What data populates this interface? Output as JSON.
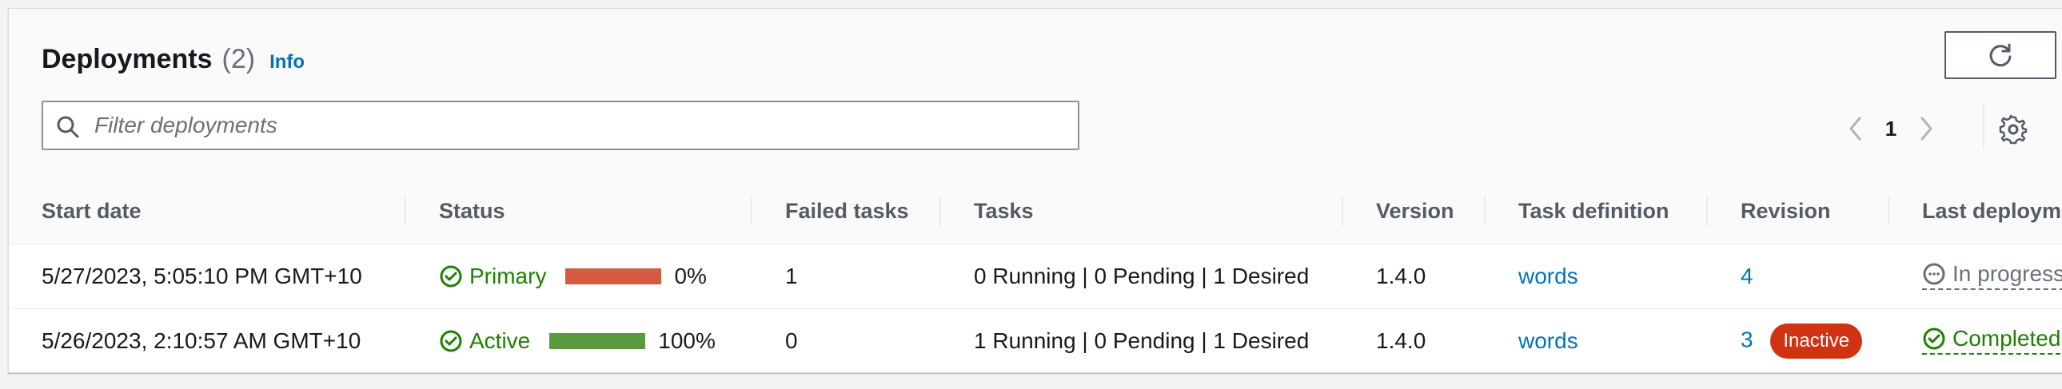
{
  "panel": {
    "title": "Deployments",
    "count": "(2)",
    "info_link": "Info"
  },
  "search": {
    "placeholder": "Filter deployments",
    "value": ""
  },
  "pagination": {
    "current_page": "1"
  },
  "table": {
    "columns": {
      "start_date": "Start date",
      "status": "Status",
      "failed_tasks": "Failed tasks",
      "tasks": "Tasks",
      "version": "Version",
      "task_definition": "Task definition",
      "revision": "Revision",
      "last_deployment": "Last deploym"
    },
    "rows": [
      {
        "start_date": "5/27/2023, 5:05:10 PM GMT+10",
        "status": "Primary",
        "progress_text": "0%",
        "progress_bar_color": "#d45b3f",
        "failed_tasks": "1",
        "tasks": "0 Running | 0 Pending | 1 Desired",
        "version": "1.4.0",
        "task_definition": "words",
        "revision": "4",
        "revision_badge": "",
        "last_deployment": "In progress"
      },
      {
        "start_date": "5/26/2023, 2:10:57 AM GMT+10",
        "status": "Active",
        "progress_text": "100%",
        "progress_bar_color": "#5a9a3f",
        "failed_tasks": "0",
        "tasks": "1 Running | 0 Pending | 1 Desired",
        "version": "1.4.0",
        "task_definition": "words",
        "revision": "3",
        "revision_badge": "Inactive",
        "last_deployment": "Completed"
      }
    ]
  },
  "colors": {
    "success": "#1d8102",
    "link": "#0073bb",
    "error_badge": "#d13212",
    "muted": "#687078"
  },
  "icons": {
    "refresh": "refresh-icon",
    "search": "search-icon",
    "prev": "chevron-left-icon",
    "next": "chevron-right-icon",
    "settings": "gear-icon",
    "status_ok": "check-circle-icon",
    "in_progress": "ellipsis-circle-icon"
  }
}
